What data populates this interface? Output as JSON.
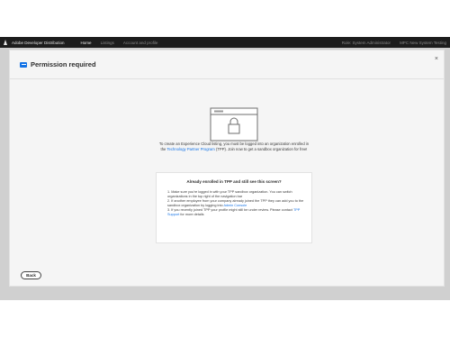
{
  "topbar": {
    "app_title": "Adobe Developer Distribution",
    "nav": [
      "Home",
      "Listings",
      "Account and profile"
    ],
    "right": [
      "Role: System Administrator",
      "MPC New System Testing"
    ]
  },
  "modal": {
    "title": "Permission required",
    "close_label": "×",
    "intro_before": "To create an Experience Cloud listing, you must be logged into an organization enrolled in the ",
    "intro_link": "Technology Partner Program",
    "intro_after": " (TPP). Join now to get a sandbox organization for free!",
    "box_title": "Already enrolled in TPP and still see this screen?",
    "steps": [
      {
        "text": "1. Make sure you're logged in with your TPP sandbox organization. You can switch organizations in the top right of the navigation bar",
        "link": ""
      },
      {
        "text": "2. If another employee from your company already joined the TPP they can add you to the sandbox organization by logging into ",
        "link": "Admin Console"
      },
      {
        "text": "3. If you recently joined TPP your profile might still be under review. Please contact ",
        "link": "TPP Support",
        "after": " for more details"
      }
    ],
    "back_label": "Back"
  },
  "colors": {
    "accent": "#1473e6",
    "topbar": "#1d1d1d",
    "backdrop": "#d0d0d0"
  }
}
